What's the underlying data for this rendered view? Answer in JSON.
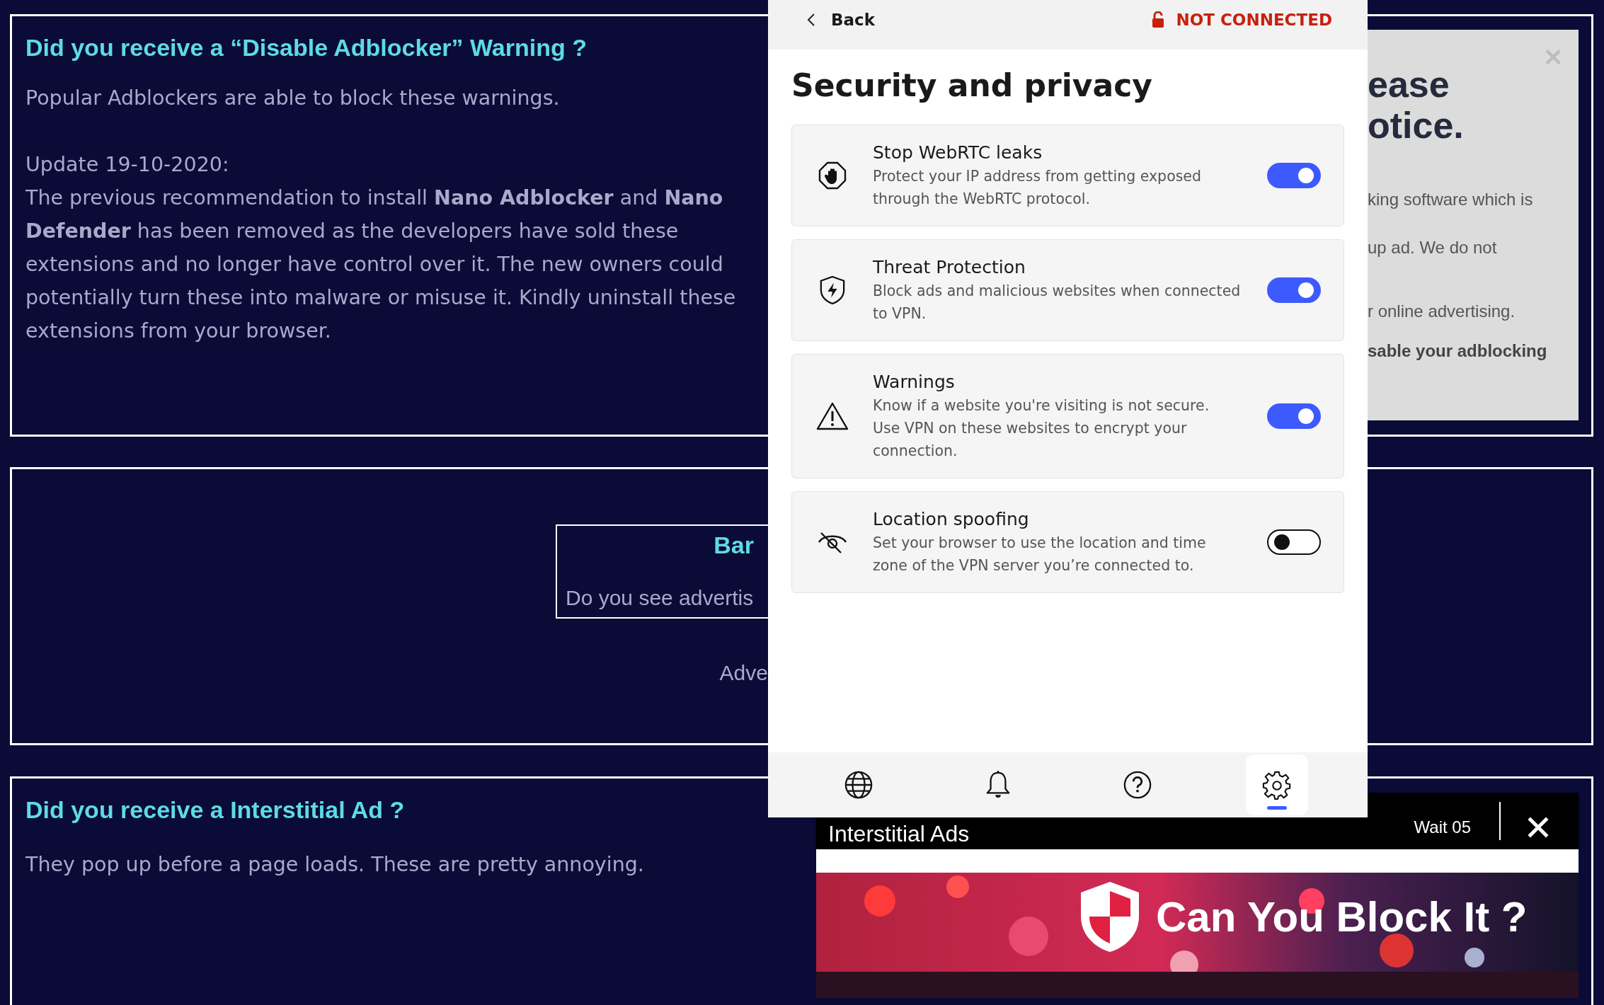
{
  "sections": [
    {
      "heading": "Did you receive a “Disable Adblocker” Warning ?",
      "paragraphs": [
        "Popular Adblockers are able to block these warnings.",
        "Update 19-10-2020:",
        "The previous recommendation to install **Nano Adblocker** and **Nano Defender** has been removed as the developers have sold these extensions and no longer have control over it. The new owners could potentially turn these into malware or misuse it. Kindly uninstall these extensions from your browser."
      ]
    },
    {
      "banner": {
        "heading": "Bar",
        "text": "Do you see advertis"
      },
      "note": "Adve"
    },
    {
      "heading": "Did you receive a Interstitial Ad ?",
      "paragraphs": [
        "They pop up before a page loads. These are pretty annoying."
      ]
    }
  ],
  "notice_modal": {
    "close": "✕",
    "title_lines": [
      "ease",
      "otice."
    ],
    "lines": [
      {
        "text": "king software which is",
        "bold": false
      },
      {
        "text": "up ad. We do not",
        "bold": false
      },
      {
        "text": "r online advertising.",
        "bold": false
      },
      {
        "text": "sable your adblocking",
        "bold": true
      }
    ]
  },
  "interstitial": {
    "title": "Interstitial Ads",
    "timer": "Wait 05",
    "banner_text": "Can You Block It ?"
  },
  "vpn_popup": {
    "back": "Back",
    "status": "NOT CONNECTED",
    "title": "Security and privacy",
    "settings": [
      {
        "kind": "hand",
        "name": "Stop WebRTC leaks",
        "description": "Protect your IP address from getting exposed through the WebRTC protocol.",
        "on": true
      },
      {
        "kind": "shield",
        "name": "Threat Protection",
        "description": "Block ads and malicious websites when connected to VPN.",
        "on": true
      },
      {
        "kind": "warning",
        "name": "Warnings",
        "description": "Know if a website you're visiting is not secure. Use VPN on these websites to encrypt your connection.",
        "on": true
      },
      {
        "kind": "eye-off",
        "name": "Location spoofing",
        "description": "Set your browser to use the location and time zone of the VPN server you’re connected to.",
        "on": false
      }
    ],
    "nav": [
      {
        "kind": "globe",
        "selected": false
      },
      {
        "kind": "bell",
        "selected": false
      },
      {
        "kind": "help",
        "selected": false
      },
      {
        "kind": "settings",
        "selected": true
      }
    ]
  }
}
